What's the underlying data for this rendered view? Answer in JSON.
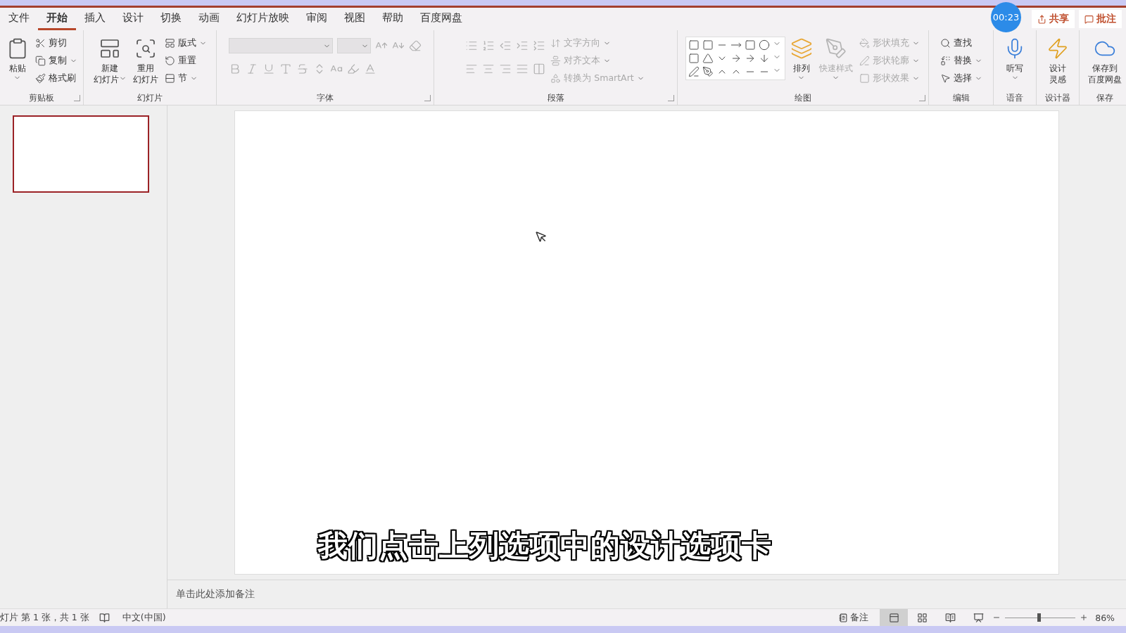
{
  "tabs": [
    {
      "label": "文件",
      "selected": false
    },
    {
      "label": "开始",
      "selected": true
    },
    {
      "label": "插入",
      "selected": false
    },
    {
      "label": "设计",
      "selected": false
    },
    {
      "label": "切换",
      "selected": false
    },
    {
      "label": "动画",
      "selected": false
    },
    {
      "label": "幻灯片放映",
      "selected": false
    },
    {
      "label": "审阅",
      "selected": false
    },
    {
      "label": "视图",
      "selected": false
    },
    {
      "label": "帮助",
      "selected": false
    },
    {
      "label": "百度网盘",
      "selected": false
    }
  ],
  "share_button": "共享",
  "comment_button": "批注",
  "timer": "00:23",
  "ribbon": [
    {
      "label": "剪贴板",
      "launcher": true,
      "items": [
        {
          "kind": "large",
          "lines": [
            "粘贴"
          ],
          "caret": true,
          "disabled": false
        },
        {
          "kind": "stack",
          "items": [
            {
              "label": "剪切",
              "caret": false,
              "disabled": false
            },
            {
              "label": "复制",
              "caret": true,
              "disabled": false
            },
            {
              "label": "格式刷",
              "caret": false,
              "disabled": false
            }
          ]
        }
      ]
    },
    {
      "label": "幻灯片",
      "launcher": false,
      "items": [
        {
          "kind": "large",
          "lines": [
            "新建",
            "幻灯片"
          ],
          "caret": true,
          "disabled": false
        },
        {
          "kind": "large",
          "lines": [
            "重用",
            "幻灯片"
          ],
          "caret": false,
          "disabled": false
        },
        {
          "kind": "stack",
          "items": [
            {
              "label": "版式",
              "caret": true,
              "disabled": false
            },
            {
              "label": "重置",
              "caret": false,
              "disabled": false
            },
            {
              "label": "节",
              "caret": true,
              "disabled": false
            }
          ]
        }
      ]
    },
    {
      "label": "字体",
      "launcher": true,
      "items": [
        {
          "kind": "font_tools",
          "disabled": true
        }
      ]
    },
    {
      "label": "段落",
      "launcher": true,
      "items": [
        {
          "kind": "paragraph_tools",
          "disabled": true
        },
        {
          "kind": "stack",
          "items": [
            {
              "label": "文字方向",
              "caret": true,
              "disabled": true
            },
            {
              "label": "对齐文本",
              "caret": true,
              "disabled": true
            },
            {
              "label": "转换为 SmartArt",
              "caret": true,
              "disabled": true
            }
          ]
        }
      ]
    },
    {
      "label": "绘图",
      "launcher": true,
      "items": [
        {
          "kind": "shape_gallery",
          "disabled": false
        },
        {
          "kind": "large",
          "lines": [
            "排列"
          ],
          "caret": true,
          "disabled": false
        },
        {
          "kind": "large",
          "lines": [
            "快速样式"
          ],
          "caret": true,
          "disabled": true
        },
        {
          "kind": "stack",
          "items": [
            {
              "label": "形状填充",
              "caret": true,
              "disabled": true
            },
            {
              "label": "形状轮廓",
              "caret": true,
              "disabled": true
            },
            {
              "label": "形状效果",
              "caret": true,
              "disabled": true
            }
          ]
        }
      ]
    },
    {
      "label": "编辑",
      "launcher": false,
      "items": [
        {
          "kind": "stack",
          "items": [
            {
              "label": "查找",
              "caret": false,
              "disabled": false
            },
            {
              "label": "替换",
              "caret": true,
              "disabled": false
            },
            {
              "label": "选择",
              "caret": true,
              "disabled": false
            }
          ]
        }
      ]
    },
    {
      "label": "语音",
      "launcher": false,
      "items": [
        {
          "kind": "large",
          "lines": [
            "听写"
          ],
          "caret": true,
          "disabled": false
        }
      ]
    },
    {
      "label": "设计器",
      "launcher": false,
      "items": [
        {
          "kind": "large",
          "lines": [
            "设计",
            "灵感"
          ],
          "caret": false,
          "disabled": false
        }
      ]
    },
    {
      "label": "保存",
      "launcher": false,
      "items": [
        {
          "kind": "large",
          "lines": [
            "保存到",
            "百度网盘"
          ],
          "caret": false,
          "disabled": false
        }
      ]
    }
  ],
  "thumbnails": [
    {
      "selected": true
    }
  ],
  "subtitle": "我们点击上列选项中的设计选项卡",
  "notes_placeholder": "单击此处添加备注",
  "status_bar": {
    "slide_info": "灯片 第 1 张，共 1 张",
    "language": "中文(中国)",
    "notes_button": "备注",
    "views": [
      {
        "selected": true
      },
      {
        "selected": false
      },
      {
        "selected": false
      },
      {
        "selected": false
      }
    ],
    "zoom": {
      "level": 0.48,
      "reading": "86%"
    }
  }
}
